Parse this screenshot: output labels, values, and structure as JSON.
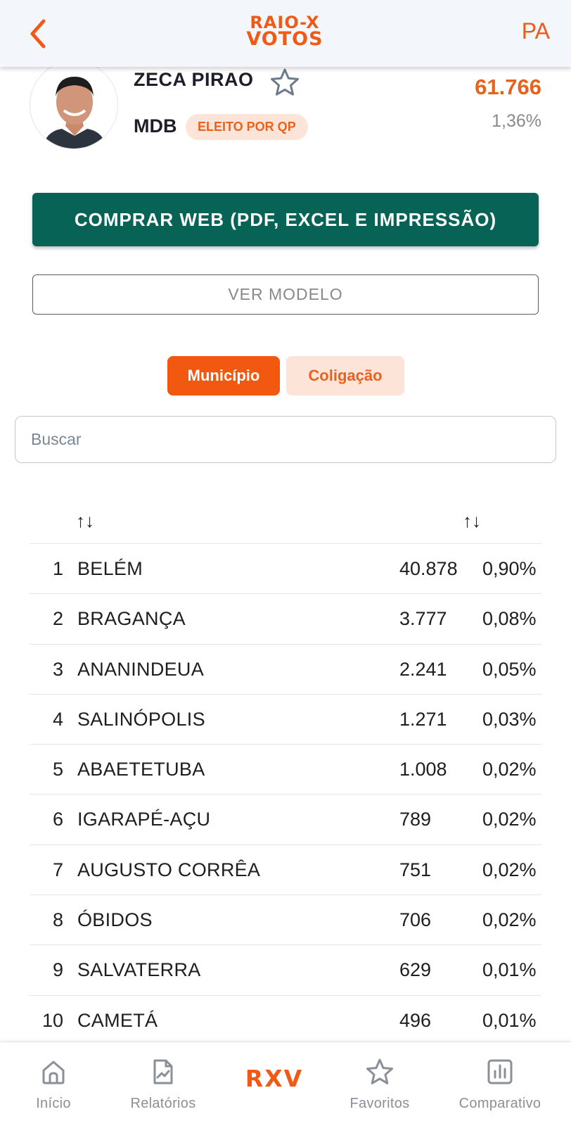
{
  "header": {
    "back_icon": "chevron-left-icon",
    "logo_line1": "RAIO-X",
    "logo_line2": "VOTOS",
    "state": "PA"
  },
  "candidate": {
    "name": "ZECA PIRAO",
    "party": "MDB",
    "badge": "ELEITO POR QP",
    "total_votes": "61.766",
    "total_pct": "1,36%",
    "favorite_icon": "star-outline-icon"
  },
  "actions": {
    "buy_label": "COMPRAR WEB (PDF, EXCEL E IMPRESSÃO)",
    "model_label": "VER MODELO"
  },
  "tabs": {
    "active": "Município",
    "inactive": "Coligação"
  },
  "search": {
    "placeholder": "Buscar"
  },
  "table": {
    "sort_symbol": "↑↓",
    "rows": [
      {
        "rank": "1",
        "name": "BELÉM",
        "votes": "40.878",
        "pct": "0,90%"
      },
      {
        "rank": "2",
        "name": "BRAGANÇA",
        "votes": "3.777",
        "pct": "0,08%"
      },
      {
        "rank": "3",
        "name": "ANANINDEUA",
        "votes": "2.241",
        "pct": "0,05%"
      },
      {
        "rank": "4",
        "name": "SALINÓPOLIS",
        "votes": "1.271",
        "pct": "0,03%"
      },
      {
        "rank": "5",
        "name": "ABAETETUBA",
        "votes": "1.008",
        "pct": "0,02%"
      },
      {
        "rank": "6",
        "name": "IGARAPÉ-AÇU",
        "votes": "789",
        "pct": "0,02%"
      },
      {
        "rank": "7",
        "name": "AUGUSTO CORRÊA",
        "votes": "751",
        "pct": "0,02%"
      },
      {
        "rank": "8",
        "name": "ÓBIDOS",
        "votes": "706",
        "pct": "0,02%"
      },
      {
        "rank": "9",
        "name": "SALVATERRA",
        "votes": "629",
        "pct": "0,01%"
      },
      {
        "rank": "10",
        "name": "CAMETÁ",
        "votes": "496",
        "pct": "0,01%"
      }
    ]
  },
  "nav": {
    "home": "Início",
    "reports": "Relatórios",
    "center": "RXV",
    "favorites": "Favoritos",
    "compare": "Comparativo"
  },
  "colors": {
    "brand_orange": "#f05a16",
    "buy_green": "#076356",
    "badge_bg": "#fde4d8"
  }
}
